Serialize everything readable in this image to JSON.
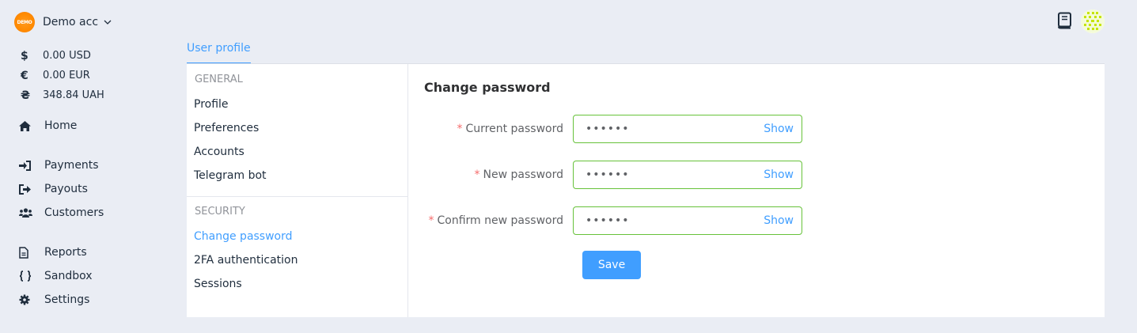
{
  "account": {
    "name": "Demo acc",
    "logo_text": "DEMO"
  },
  "balances": [
    {
      "symbol": "$",
      "amount": "0.00 USD"
    },
    {
      "symbol": "€",
      "amount": "0.00 EUR"
    },
    {
      "symbol": "₴",
      "amount": "348.84 UAH"
    }
  ],
  "nav": {
    "home": "Home",
    "payments": "Payments",
    "payouts": "Payouts",
    "customers": "Customers",
    "reports": "Reports",
    "sandbox": "Sandbox",
    "settings": "Settings"
  },
  "tabs": {
    "user_profile": "User profile"
  },
  "submenu": {
    "general_heading": "GENERAL",
    "profile": "Profile",
    "preferences": "Preferences",
    "accounts": "Accounts",
    "telegram_bot": "Telegram bot",
    "security_heading": "SECURITY",
    "change_password": "Change password",
    "twofa": "2FA authentication",
    "sessions": "Sessions"
  },
  "form": {
    "title": "Change password",
    "current_label": "Current password",
    "new_label": "New password",
    "confirm_label": "Confirm new password",
    "required_mark": "*",
    "current_value": "••••••",
    "new_value": "••••••",
    "confirm_value": "••••••",
    "show_label": "Show",
    "save_label": "Save"
  },
  "colors": {
    "accent": "#409eff",
    "valid_border": "#67c23a",
    "required": "#f56c6c",
    "page_bg": "#eaedf4"
  }
}
